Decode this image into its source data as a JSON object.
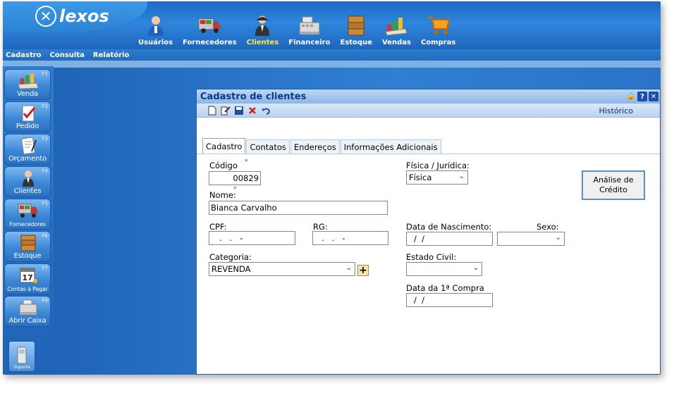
{
  "app": {
    "logo_text": "lexos"
  },
  "topnav": [
    {
      "label": "Usuários",
      "icon": "user-icon"
    },
    {
      "label": "Fornecedores",
      "icon": "truck-icon"
    },
    {
      "label": "Clientes",
      "icon": "client-icon",
      "active": true
    },
    {
      "label": "Financeiro",
      "icon": "cash-register-icon"
    },
    {
      "label": "Estoque",
      "icon": "boxes-icon"
    },
    {
      "label": "Vendas",
      "icon": "sales-chart-icon"
    },
    {
      "label": "Compras",
      "icon": "cart-icon"
    }
  ],
  "menubar": {
    "cadastro": "Cadastro",
    "consulta": "Consulta",
    "relatorio": "Relatório"
  },
  "sidebar": [
    {
      "label": "Venda",
      "key": "F1",
      "icon": "sale-icon"
    },
    {
      "label": "Pedido",
      "key": "F2",
      "icon": "order-icon"
    },
    {
      "label": "Orçamento",
      "key": "F3",
      "icon": "quote-icon"
    },
    {
      "label": "Clientes",
      "key": "F4",
      "icon": "client-icon"
    },
    {
      "label": "Fornecedores",
      "key": "F5",
      "icon": "truck-icon"
    },
    {
      "label": "Estoque",
      "key": "F6",
      "icon": "boxes-icon"
    },
    {
      "label": "Contas à Pagar",
      "key": "F7",
      "icon": "calendar-icon",
      "calendar_day": "17"
    },
    {
      "label": "Abrir Caixa",
      "key": "F8",
      "icon": "cash-register-icon"
    }
  ],
  "suporte": {
    "label": "Suporte"
  },
  "dialog": {
    "title": "Cadastro de clientes",
    "historico": "Histórico",
    "tabs": [
      "Cadastro",
      "Contatos",
      "Endereços",
      "Informações Adicionais"
    ],
    "codigo": {
      "label": "Código",
      "value": "00829"
    },
    "nome": {
      "label": "Nome:",
      "value": "Bianca Carvalho"
    },
    "cpf": {
      "label": "CPF:",
      "value": ".   .   -"
    },
    "rg": {
      "label": "RG:",
      "value": ".   .   -"
    },
    "categoria": {
      "label": "Categoria:",
      "value": "REVENDA"
    },
    "fisica_juridica": {
      "label": "Física / Jurídica:",
      "value": "Física"
    },
    "data_nascimento": {
      "label": "Data de Nascimento:",
      "value": "/  /"
    },
    "sexo": {
      "label": "Sexo:",
      "value": ""
    },
    "estado_civil": {
      "label": "Estado Civil:",
      "value": ""
    },
    "data_compra": {
      "label": "Data da 1ª Compra",
      "value": "/  /"
    },
    "analise_button": "Análise de Crédito"
  },
  "colors": {
    "accent": "#2a74c8",
    "active_nav": "#ffe83a",
    "title": "#0b3a8a"
  }
}
